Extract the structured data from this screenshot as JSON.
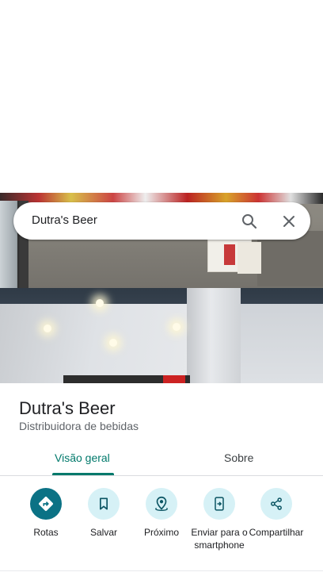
{
  "search": {
    "value": "Dutra's Beer"
  },
  "place": {
    "title": "Dutra's Beer",
    "category": "Distribuidora de bebidas"
  },
  "tabs": [
    {
      "label": "Visão geral",
      "active": true
    },
    {
      "label": "Sobre",
      "active": false
    }
  ],
  "actions": [
    {
      "label": "Rotas",
      "icon": "directions-icon"
    },
    {
      "label": "Salvar",
      "icon": "bookmark-icon"
    },
    {
      "label": "Próximo",
      "icon": "nearby-icon"
    },
    {
      "label": "Enviar para o smartphone",
      "icon": "send-to-phone-icon"
    },
    {
      "label": "Compartilhar",
      "icon": "share-icon"
    }
  ],
  "colors": {
    "accent": "#00796b",
    "primary_action": "#0b7285",
    "action_bg": "#d6f1f6"
  }
}
